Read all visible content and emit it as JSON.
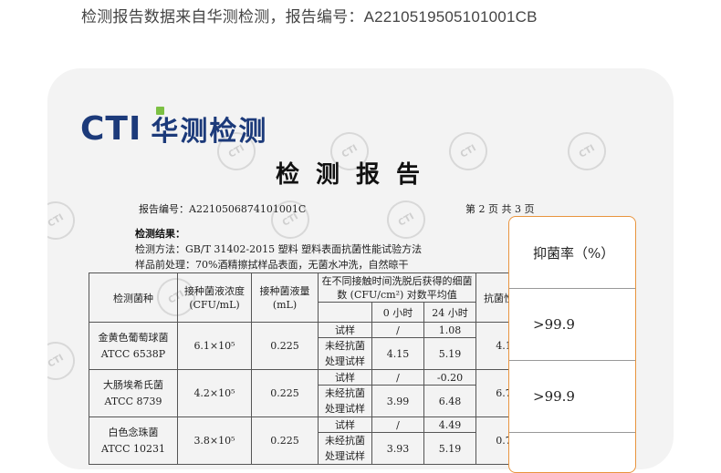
{
  "caption": "检测报告数据来自华测检测，报告编号：A2210519505101001CB",
  "logo": {
    "cti": "CTI",
    "name": "华测检测"
  },
  "watermark": "CTI",
  "doc_title": "检测报告",
  "report_no": "报告编号：A2210506874101001C",
  "page_info": "第 2 页 共 3 页",
  "result_heading": "检测结果：",
  "method": "检测方法：GB/T 31402-2015 塑料 塑料表面抗菌性能试验方法",
  "pretreatment": "样品前处理：70%酒精擦拭样品表面，无菌水冲洗，自然晾干",
  "table": {
    "h_strain": "检测菌种",
    "h_conc": "接种菌液浓度(CFU/mL)",
    "h_vol": "接种菌液量(mL)",
    "h_count": "在不同接触时间洗脱后获得的细菌数 (CFU/cm²) 对数平均值",
    "h_0h": "0 小时",
    "h_24h": "24 小时",
    "h_rate": "抗菌性能",
    "rows": [
      {
        "strain": "金黄色葡萄球菌",
        "code": "ATCC 6538P",
        "conc": "6.1×10⁵",
        "vol": "0.225",
        "s1": "试样",
        "s1_0": "/",
        "s1_24": "1.08",
        "s2a": "未经抗菌",
        "s2b": "处理试样",
        "s2_0": "4.15",
        "s2_24": "5.19",
        "rate": "4.1"
      },
      {
        "strain": "大肠埃希氏菌",
        "code": "ATCC 8739",
        "conc": "4.2×10⁵",
        "vol": "0.225",
        "s1": "试样",
        "s1_0": "/",
        "s1_24": "-0.20",
        "s2a": "未经抗菌",
        "s2b": "处理试样",
        "s2_0": "3.99",
        "s2_24": "6.48",
        "rate": "6.7"
      },
      {
        "strain": "白色念珠菌",
        "code": "ATCC 10231",
        "conc": "3.8×10⁵",
        "vol": "0.225",
        "s1": "试样",
        "s1_0": "/",
        "s1_24": "4.49",
        "s2a": "未经抗菌",
        "s2b": "处理试样",
        "s2_0": "3.93",
        "s2_24": "5.19",
        "rate": "0.7"
      }
    ]
  },
  "overlay": {
    "header": "抑菌率（%）",
    "v1": ">99.9",
    "v2": ">99.9"
  }
}
